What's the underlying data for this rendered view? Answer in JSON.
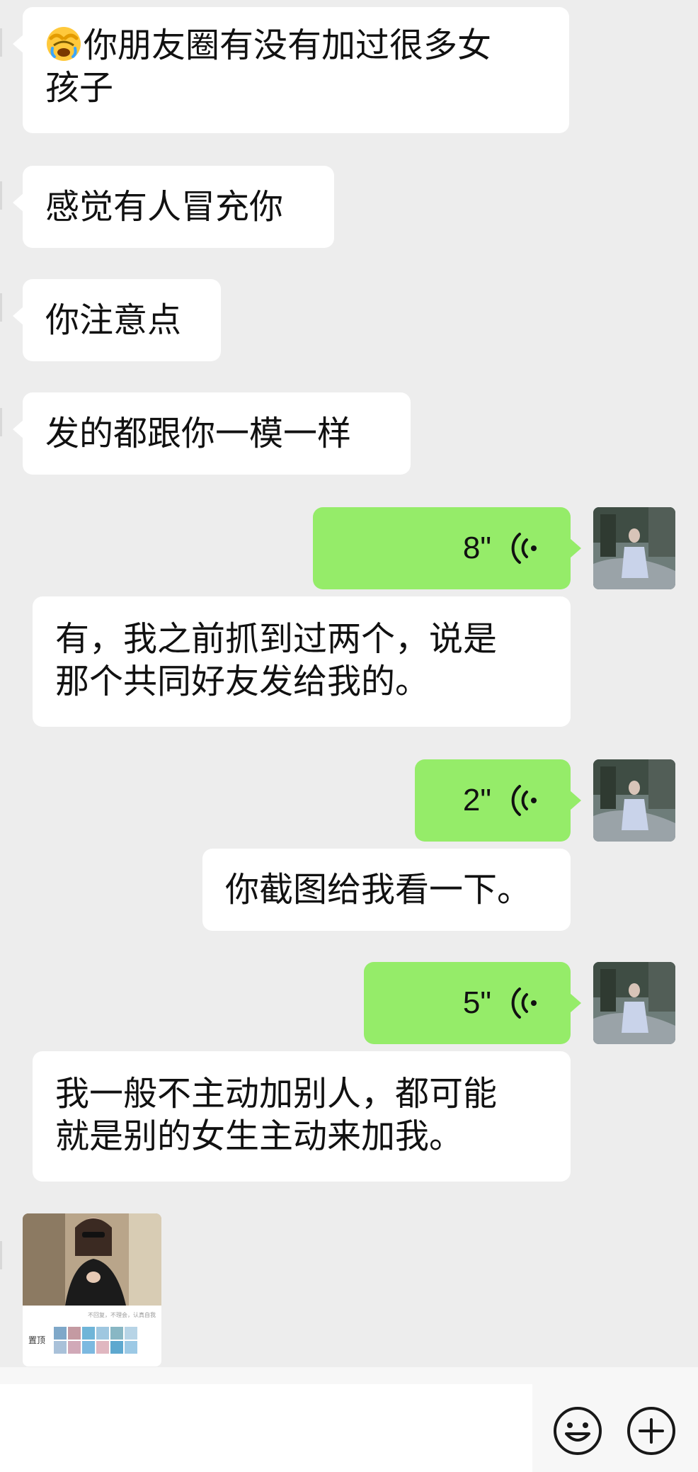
{
  "messages": [
    {
      "side": "left",
      "type": "text",
      "emoji": "face-with-hand-over-eyes",
      "line1": "你朋友圈有没有加过很多女",
      "line2": "孩子"
    },
    {
      "side": "left",
      "type": "text",
      "text": "感觉有人冒充你"
    },
    {
      "side": "left",
      "type": "text",
      "text": "你注意点"
    },
    {
      "side": "left",
      "type": "text",
      "text": "发的都跟你一模一样"
    },
    {
      "side": "right",
      "type": "voice",
      "duration": "8\""
    },
    {
      "side": "right",
      "type": "transcript",
      "line1": "有，我之前抓到过两个，说是",
      "line2": "那个共同好友发给我的。"
    },
    {
      "side": "right",
      "type": "voice",
      "duration": "2\""
    },
    {
      "side": "right",
      "type": "transcript",
      "text": "你截图给我看一下。"
    },
    {
      "side": "right",
      "type": "voice",
      "duration": "5\""
    },
    {
      "side": "right",
      "type": "transcript",
      "line1": "我一般不主动加别人，都可能",
      "line2": "就是别的女生主动来加我。"
    }
  ],
  "screenshot_thumb": {
    "tiny_text": "不回复，不理会，认真自我",
    "pin_label": "置顶"
  },
  "input_bar": {
    "emoji_icon": "smiley-icon",
    "plus_icon": "plus-circle-icon"
  },
  "colors": {
    "background": "#ededed",
    "bubble_white": "#ffffff",
    "bubble_green": "#95ec69"
  }
}
